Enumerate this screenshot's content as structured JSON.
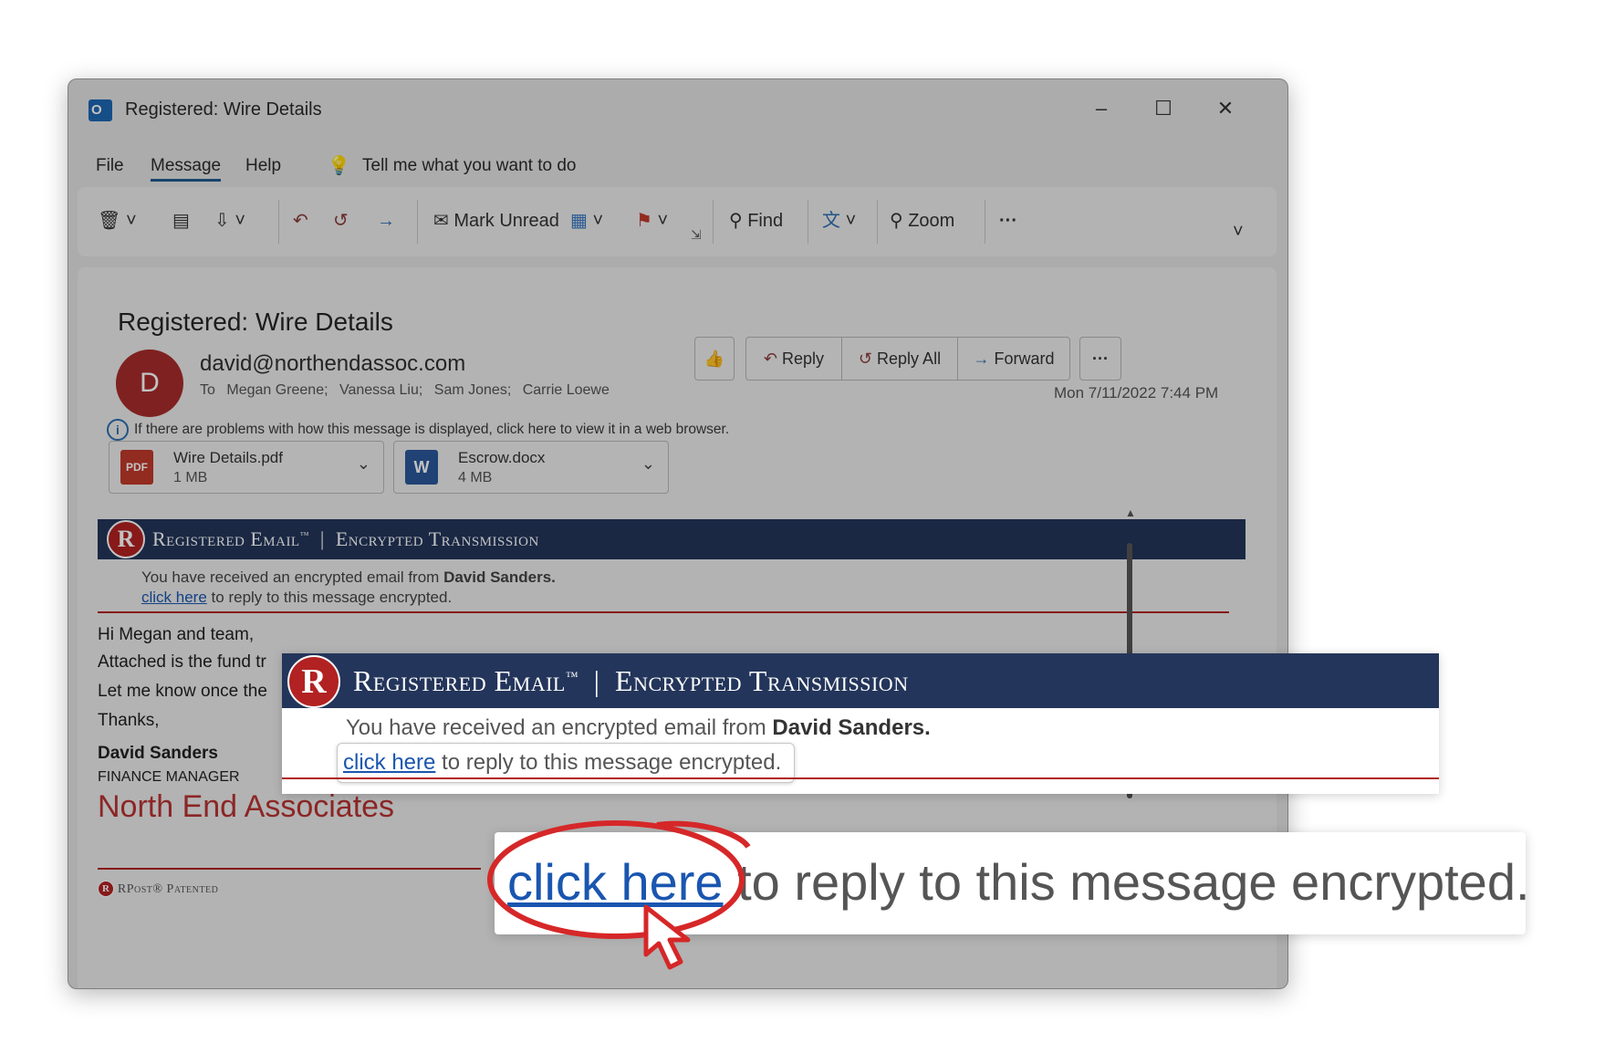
{
  "window": {
    "title": "Registered: Wire Details"
  },
  "menu": {
    "file": "File",
    "message": "Message",
    "help": "Help",
    "tell_me": "Tell me what you want to do"
  },
  "ribbon": {
    "mark_unread": "Mark Unread",
    "find": "Find",
    "zoom": "Zoom",
    "more": "···"
  },
  "message": {
    "subject": "Registered: Wire Details",
    "avatar_letter": "D",
    "sender": "david@northendassoc.com",
    "to_label": "To",
    "recipients": [
      "Megan Greene;",
      "Vanessa Liu;",
      "Sam Jones;",
      "Carrie Loewe"
    ],
    "date": "Mon 7/11/2022 7:44 PM",
    "info": "If there are problems with how this message is displayed, click here to view it in a web browser.",
    "actions": {
      "reply": "Reply",
      "reply_all": "Reply All",
      "forward": "Forward",
      "more": "···"
    }
  },
  "attachments": [
    {
      "name": "Wire Details.pdf",
      "size": "1 MB",
      "type_label": "PDF",
      "color": "#c0392b"
    },
    {
      "name": "Escrow.docx",
      "size": "4 MB",
      "type_label": "W",
      "color": "#2b579a"
    }
  ],
  "registered": {
    "logo": "R",
    "title_left": "Registered Email",
    "tm": "™",
    "divider": "|",
    "title_right": "Encrypted Transmission",
    "received_prefix": "You have received an encrypted email from",
    "sender_name": "David Sanders.",
    "link_text": "click here",
    "link_suffix": "to reply to this message encrypted."
  },
  "body": {
    "greeting": "Hi Megan and team,",
    "line1": "Attached is the fund tr",
    "line2": "Let me know once the",
    "thanks": "Thanks,",
    "sig_name": "David Sanders",
    "sig_title": "FINANCE MANAGER",
    "company": "North End Associates",
    "footer": "RPost® Patented"
  },
  "colors": {
    "banner": "#23355a",
    "accent_red": "#b22222",
    "link": "#1a56b0",
    "company": "#b83232"
  }
}
